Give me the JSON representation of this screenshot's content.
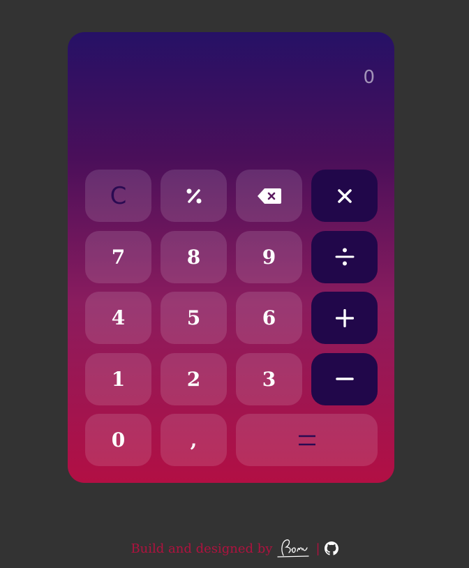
{
  "display": {
    "value": "0"
  },
  "keys": {
    "clear": "C",
    "seven": "7",
    "eight": "8",
    "nine": "9",
    "four": "4",
    "five": "5",
    "six": "6",
    "one": "1",
    "two": "2",
    "three": "3",
    "zero": "0",
    "comma": ","
  },
  "icons": {
    "percent": "percent-icon",
    "backspace": "backspace-icon",
    "multiply": "multiply-icon",
    "divide": "divide-icon",
    "plus": "plus-icon",
    "minus": "minus-icon",
    "equals": "equals-icon",
    "github": "github-icon"
  },
  "footer": {
    "text": "Build and designed by",
    "signature": "Rohu",
    "separator": "|"
  },
  "colors": {
    "background": "#333333",
    "gradient_top": "#261166",
    "gradient_bottom": "#b20f44",
    "operator_key": "#21074a",
    "footer_text": "#b0123f"
  }
}
